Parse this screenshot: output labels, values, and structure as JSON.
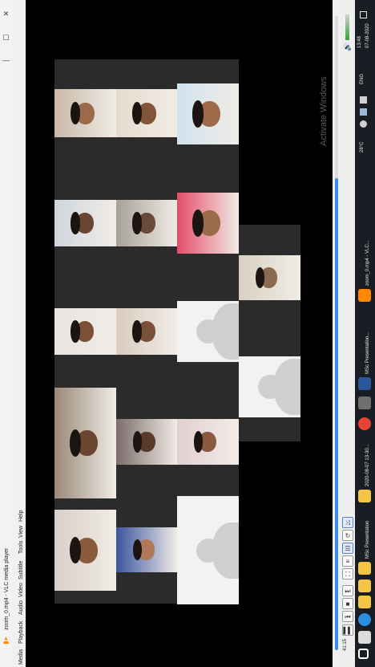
{
  "window": {
    "title": "zoom_0.mp4 - VLC media player",
    "minimize_label": "—",
    "maximize_label": "☐",
    "close_label": "✕"
  },
  "menu": [
    {
      "label": "Media"
    },
    {
      "label": "Playback"
    },
    {
      "label": "Audio"
    },
    {
      "label": "Video"
    },
    {
      "label": "Subtitle"
    },
    {
      "label": "Tools"
    },
    {
      "label": "View"
    },
    {
      "label": "Help"
    }
  ],
  "video": {
    "watermark": "Activate Windows",
    "tiles": [
      {
        "kind": "photo",
        "color": "#d8cfc8",
        "skin": "#8a5a3c"
      },
      {
        "kind": "photo",
        "color": "#9a8a78",
        "skin": "#6a4632"
      },
      {
        "kind": "photo",
        "color": "#e8e4df",
        "skin": "#7a5038"
      },
      {
        "kind": "photo",
        "color": "#cfd6df",
        "skin": "#6a4632"
      },
      {
        "kind": "photo",
        "color": "#c9b9a7",
        "skin": "#9a6a4a"
      },
      {
        "kind": "photo",
        "color": "#3a55a0",
        "skin": "#b07a5a"
      },
      {
        "kind": "photo",
        "color": "#7c6e6b",
        "skin": "#5a3a28"
      },
      {
        "kind": "photo",
        "color": "#d9ccc0",
        "skin": "#7a5038"
      },
      {
        "kind": "photo",
        "color": "#a7a198",
        "skin": "#6a4a38"
      },
      {
        "kind": "photo",
        "color": "#e5dccf",
        "skin": "#805538"
      },
      {
        "kind": "photo",
        "color": "#cfe3ee",
        "skin": "#a06a4a"
      },
      {
        "kind": "avatar"
      },
      {
        "kind": "photo",
        "color": "#e2cfd2",
        "skin": "#8a5a40"
      },
      {
        "kind": "photo",
        "color": "#dfe4ea",
        "skin": "#b08060"
      },
      {
        "kind": "photo",
        "color": "#e6d2b0",
        "skin": "#8a5a3c"
      },
      {
        "kind": "photo",
        "color": "#e54d6a",
        "skin": "#9a6a4a"
      },
      {
        "kind": "avatar"
      },
      {
        "kind": "photo",
        "color": "#d7d0c2",
        "skin": "#8a6a50"
      },
      {
        "kind": "avatar"
      },
      {
        "kind": "avatar"
      }
    ]
  },
  "controls": {
    "time_elapsed": "41:15",
    "buttons": [
      "play-pause",
      "stop",
      "previous",
      "next",
      "fullscreen",
      "extended-settings",
      "playlist",
      "loop",
      "shuffle"
    ],
    "volume_percent": 100,
    "progress_fraction": 0.74
  },
  "taskbar": {
    "apps": [
      {
        "name": "start-icon",
        "label": "",
        "color": "#ffffff"
      },
      {
        "name": "search-icon",
        "label": "",
        "color": "#dcdcdc"
      },
      {
        "name": "edge-icon",
        "label": "",
        "color": "#2c8ee0"
      },
      {
        "name": "explorer-icon",
        "label": "",
        "color": "#f4c542"
      },
      {
        "name": "folder-icon",
        "label": "",
        "color": "#f4c542"
      },
      {
        "name": "file-explorer-task",
        "label": "MSc Presentation",
        "color": "#f4c542"
      },
      {
        "name": "folder-task",
        "label": "2020-08-07 13-30...",
        "color": "#f4c542"
      },
      {
        "name": "chrome-icon",
        "label": "",
        "color": "#e94235"
      },
      {
        "name": "store-icon",
        "label": "",
        "color": "#6f6f6f"
      },
      {
        "name": "word-task",
        "label": "MSc Presentation...",
        "color": "#2b579a"
      },
      {
        "name": "vlc-task",
        "label": "zoom_0.mp4 - VLC...",
        "color": "#ff8800"
      }
    ],
    "tray": {
      "weather": "28°C",
      "language": "ENG",
      "time": "13:48",
      "date": "07-08-2020"
    }
  },
  "colors": {
    "video_bg": "#000000",
    "empty_tile": "#2b2b2b",
    "seek_fill": "#3a8ee6",
    "taskbar_bg": "#1a1d24"
  }
}
